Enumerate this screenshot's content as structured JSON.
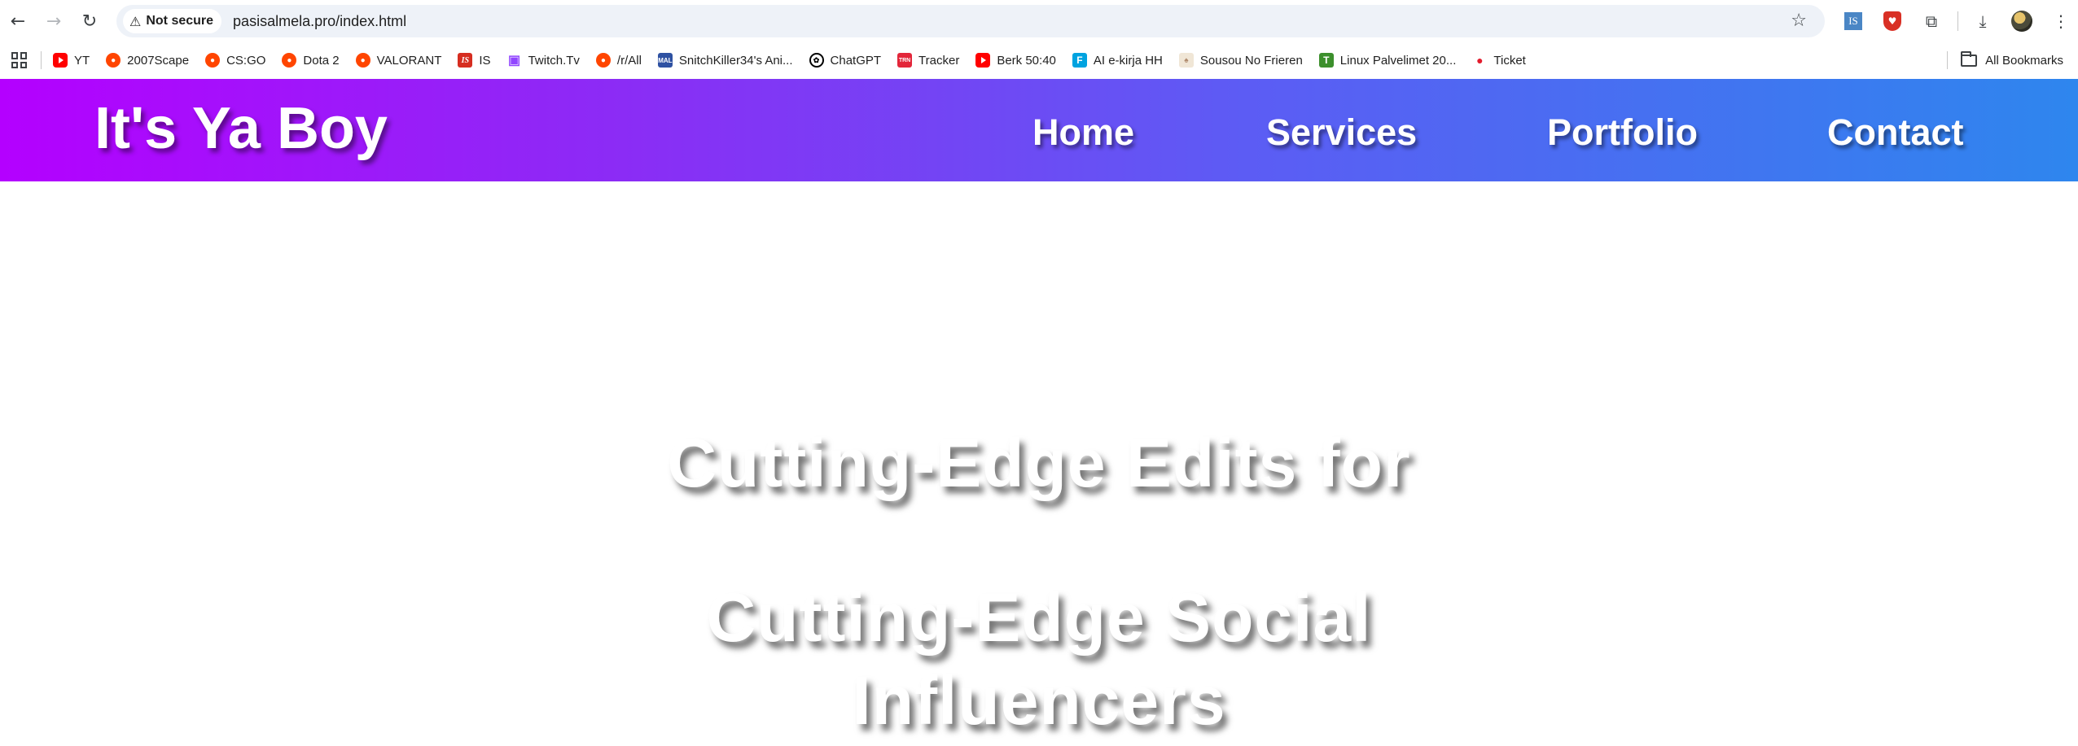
{
  "browser": {
    "url": "pasisalmela.pro/index.html",
    "security_label": "Not secure",
    "bookmarks": [
      {
        "label": "YT",
        "icon": "youtube-icon"
      },
      {
        "label": "2007Scape",
        "icon": "reddit-icon"
      },
      {
        "label": "CS:GO",
        "icon": "reddit-icon"
      },
      {
        "label": "Dota 2",
        "icon": "reddit-icon"
      },
      {
        "label": "VALORANT",
        "icon": "reddit-icon"
      },
      {
        "label": "IS",
        "icon": "is-icon"
      },
      {
        "label": "Twitch.Tv",
        "icon": "twitch-icon"
      },
      {
        "label": "/r/All",
        "icon": "reddit-icon"
      },
      {
        "label": "SnitchKiller34's Ani...",
        "icon": "mal-icon"
      },
      {
        "label": "ChatGPT",
        "icon": "chatgpt-icon"
      },
      {
        "label": "Tracker",
        "icon": "tracker-icon"
      },
      {
        "label": "Berk 50:40",
        "icon": "youtube-icon"
      },
      {
        "label": "AI e-kirja HH",
        "icon": "ai-ekirja-icon"
      },
      {
        "label": "Sousou No Frieren",
        "icon": "anime-icon"
      },
      {
        "label": "Linux Palvelimet 20...",
        "icon": "linux-icon"
      },
      {
        "label": "Ticket",
        "icon": "ticket-icon"
      }
    ],
    "all_bookmarks_label": "All Bookmarks"
  },
  "site": {
    "logo": "It's Ya Boy",
    "nav": [
      "Home",
      "Services",
      "Portfolio",
      "Contact"
    ],
    "hero": {
      "line1": "Cutting-Edge Edits for",
      "line2": "Cutting-Edge Social",
      "line3": "Influencers"
    },
    "colors": {
      "header_gradient_start": "#b400ff",
      "header_gradient_end": "#2e86ee",
      "text": "#ffffff",
      "background": "#ffffff"
    }
  }
}
